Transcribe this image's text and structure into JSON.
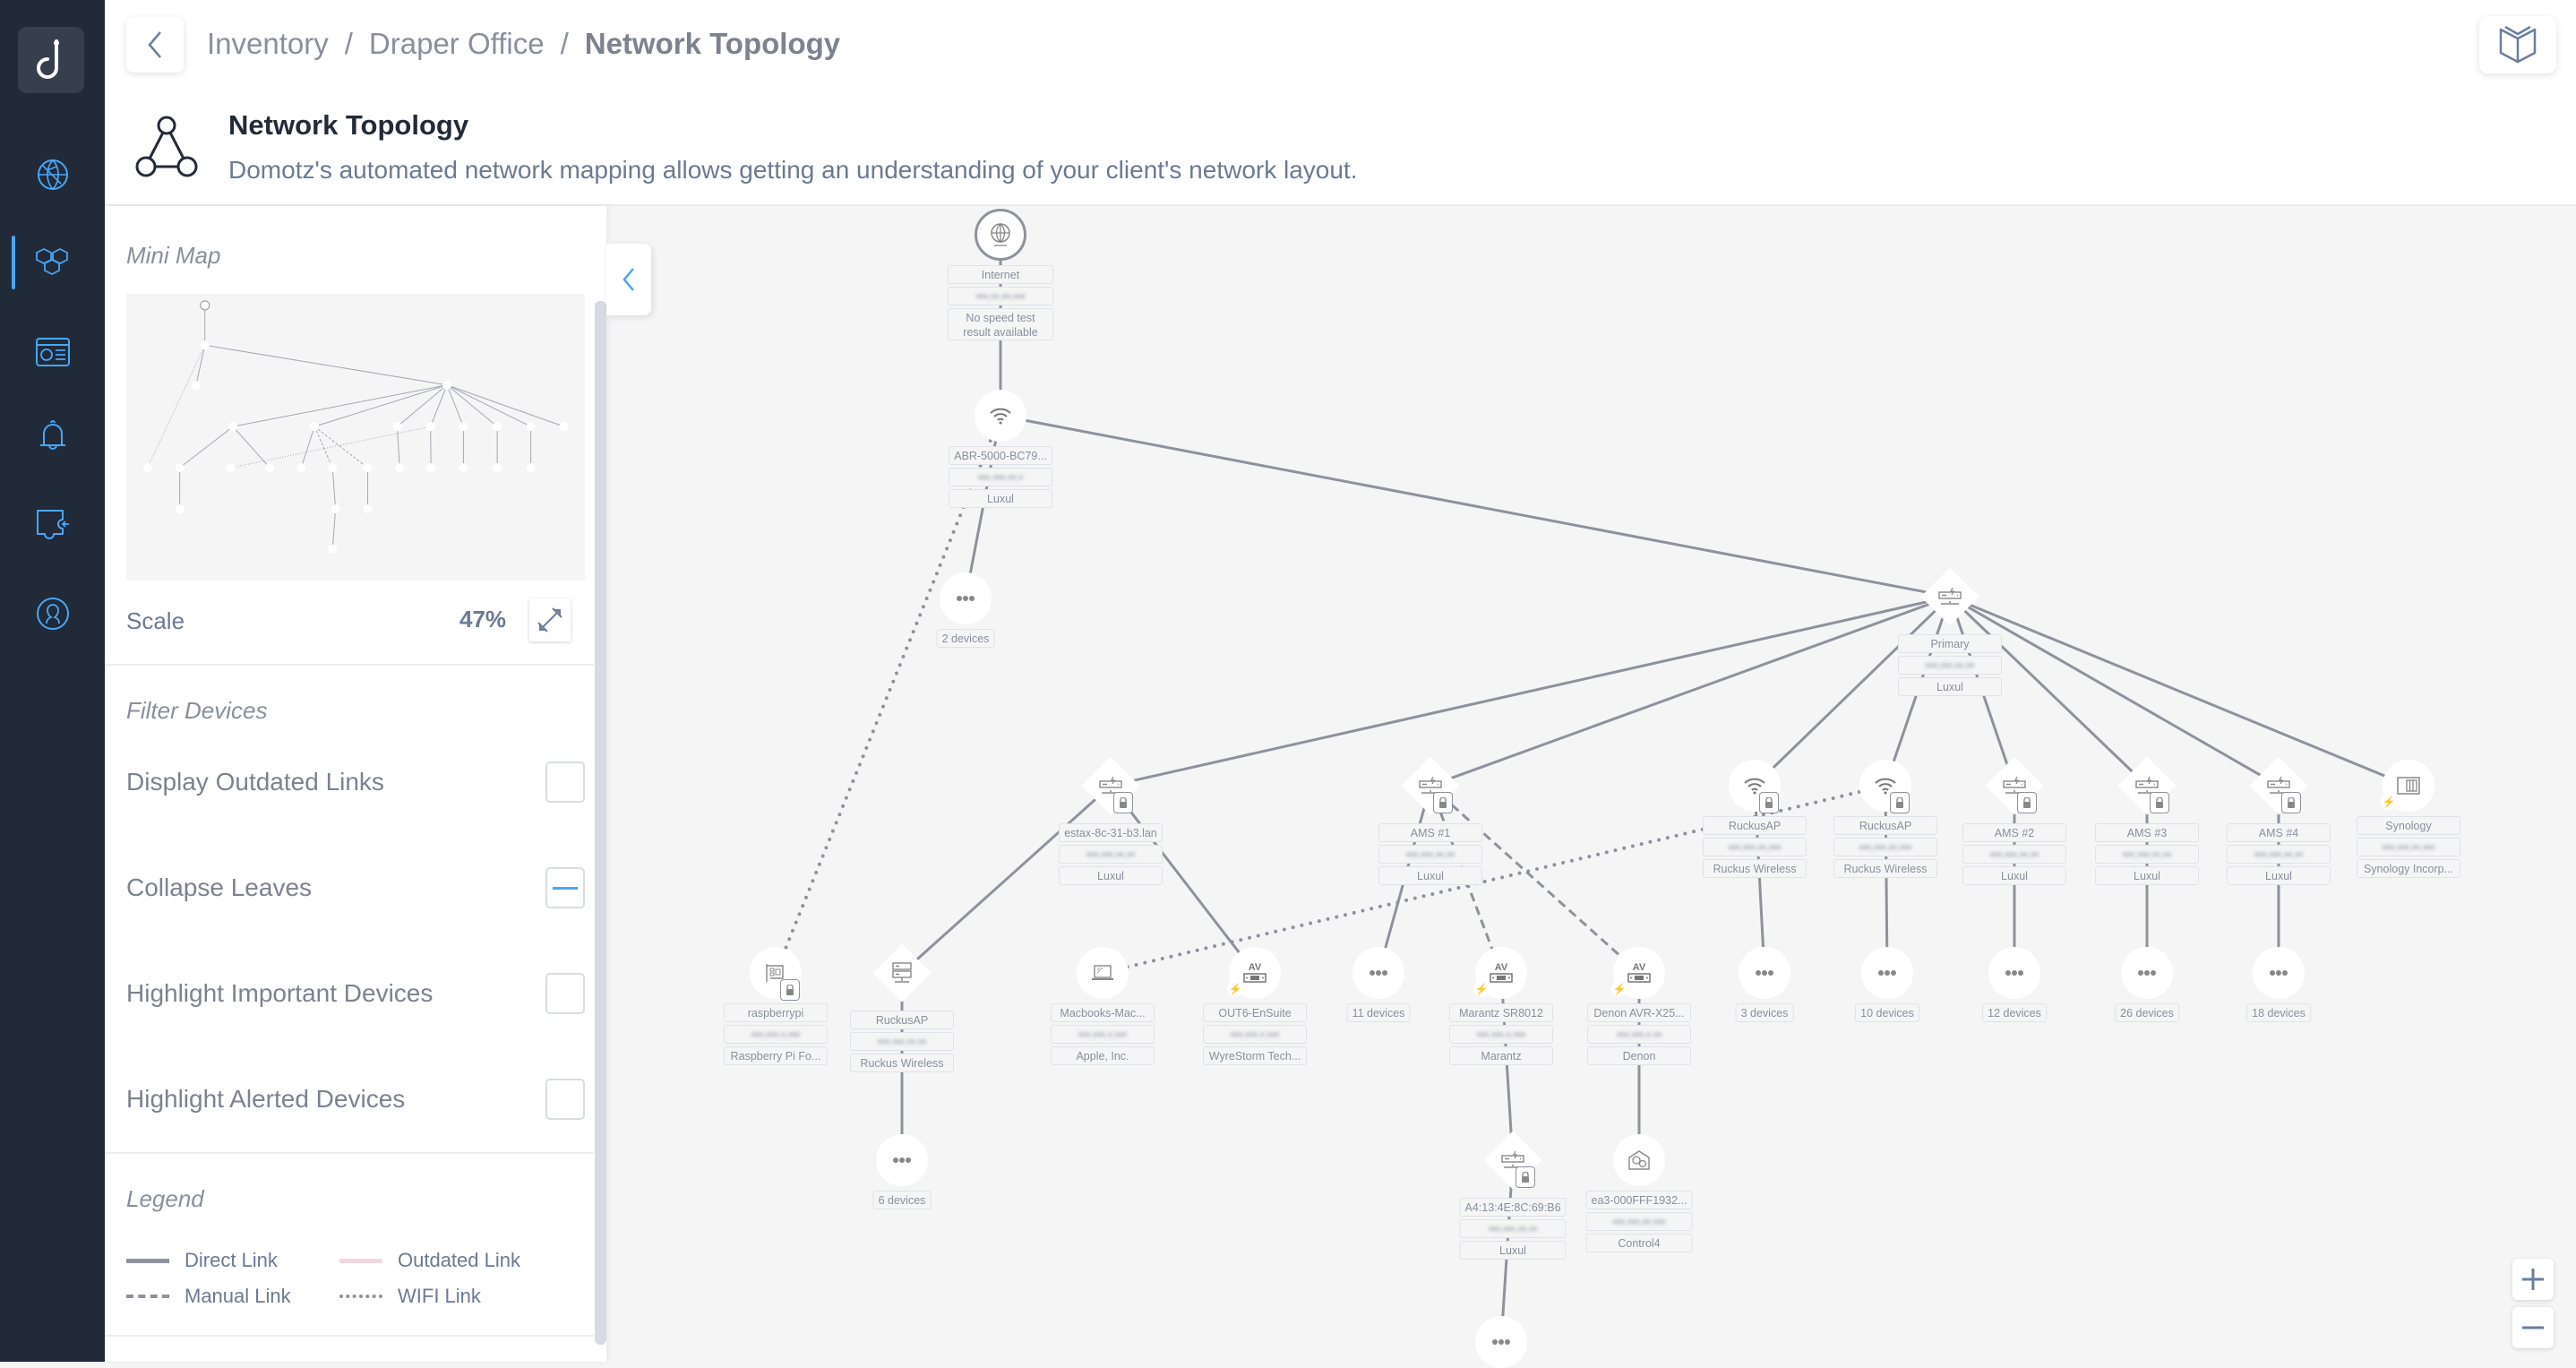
{
  "breadcrumb": {
    "items": [
      "Inventory",
      "Draper Office"
    ],
    "current": "Network Topology",
    "separator": "/"
  },
  "page": {
    "title": "Network Topology",
    "subtitle": "Domotz's automated network mapping allows getting an understanding of your client's network layout."
  },
  "sidebar": {
    "items": [
      {
        "icon": "globe-network-icon",
        "active": false
      },
      {
        "icon": "cubes-inventory-icon",
        "active": true
      },
      {
        "icon": "dashboard-window-icon",
        "active": false
      },
      {
        "icon": "bell-icon",
        "active": false
      },
      {
        "icon": "integration-puzzle-icon",
        "active": false
      },
      {
        "icon": "user-support-icon",
        "active": false
      }
    ]
  },
  "panel": {
    "minimap_title": "Mini Map",
    "scale_label": "Scale",
    "scale_value": "47%",
    "filter_title": "Filter Devices",
    "filters": [
      {
        "label": "Display Outdated Links",
        "state": "unchecked"
      },
      {
        "label": "Collapse Leaves",
        "state": "indeterminate"
      },
      {
        "label": "Highlight Important Devices",
        "state": "unchecked"
      },
      {
        "label": "Highlight Alerted Devices",
        "state": "unchecked"
      }
    ],
    "legend_title": "Legend",
    "legend": [
      {
        "label": "Direct Link",
        "style": "solid",
        "color": "#8f929c"
      },
      {
        "label": "Outdated Link",
        "style": "solid",
        "color": "#f4d6df"
      },
      {
        "label": "Manual Link",
        "style": "dashed",
        "color": "#8f929c"
      },
      {
        "label": "WIFI Link",
        "style": "dotted",
        "color": "#8f929c"
      }
    ]
  },
  "colors": {
    "accent": "#4aa6f5",
    "sidebar_bg": "#212a38",
    "link": "#8f929c",
    "text_muted": "#8a8f9c"
  },
  "topology": {
    "nodes": [
      {
        "id": "internet",
        "shape": "internet",
        "icon": "globe-icon",
        "labels": [
          "Internet",
          "•••.••.••.•••"
        ],
        "extra": "No speed test result available",
        "blur": [
          1
        ]
      },
      {
        "id": "abr",
        "shape": "circle",
        "icon": "wifi-icon",
        "labels": [
          "ABR-5000-BC79...",
          "•••.•••.••.•",
          "Luxul"
        ],
        "blur": [
          1
        ]
      },
      {
        "id": "g2",
        "shape": "circle",
        "icon": "more-dots-icon",
        "labels": [
          "2 devices"
        ]
      },
      {
        "id": "primary",
        "shape": "diamond",
        "icon": "switch-icon",
        "labels": [
          "Primary",
          "•••.•••.••.••",
          "Luxul"
        ],
        "blur": [
          1
        ]
      },
      {
        "id": "estax",
        "shape": "diamond",
        "icon": "switch-icon",
        "lock": true,
        "labels": [
          "estax-8c-31-b3.lan",
          "•••.•••.••.••",
          "Luxul"
        ],
        "blur": [
          1
        ]
      },
      {
        "id": "ams1",
        "shape": "diamond",
        "icon": "switch-icon",
        "lock": true,
        "labels": [
          "AMS #1",
          "•••.•••.••.••",
          "Luxul"
        ],
        "blur": [
          1
        ]
      },
      {
        "id": "ruckus1",
        "shape": "circle",
        "icon": "wifi-icon",
        "lock": true,
        "labels": [
          "RuckusAP",
          "•••.•••.••.•••",
          "Ruckus Wireless"
        ],
        "blur": [
          1
        ]
      },
      {
        "id": "ruckus2",
        "shape": "circle",
        "icon": "wifi-icon",
        "lock": true,
        "labels": [
          "RuckusAP",
          "•••.•••.••.•••",
          "Ruckus Wireless"
        ],
        "blur": [
          1
        ]
      },
      {
        "id": "ams2",
        "shape": "diamond",
        "icon": "switch-icon",
        "lock": true,
        "labels": [
          "AMS #2",
          "•••.•••.••.••",
          "Luxul"
        ],
        "blur": [
          1
        ]
      },
      {
        "id": "ams3",
        "shape": "diamond",
        "icon": "switch-icon",
        "lock": true,
        "labels": [
          "AMS #3",
          "•••.•••.••.••",
          "Luxul"
        ],
        "blur": [
          1
        ]
      },
      {
        "id": "ams4",
        "shape": "diamond",
        "icon": "switch-icon",
        "lock": true,
        "labels": [
          "AMS #4",
          "•••.•••.••.••",
          "Luxul"
        ],
        "blur": [
          1
        ]
      },
      {
        "id": "synology",
        "shape": "circle",
        "icon": "nas-icon",
        "bolt": true,
        "labels": [
          "Synology",
          "•••.•••.••.•••",
          "Synology Incorp..."
        ],
        "blur": [
          1
        ]
      },
      {
        "id": "rpi",
        "shape": "circle",
        "icon": "circuit-board-icon",
        "lock": true,
        "labels": [
          "raspberrypi",
          "•••.•••.•.•••",
          "Raspberry Pi Fo..."
        ],
        "blur": [
          1
        ]
      },
      {
        "id": "ruckus3",
        "shape": "diamond",
        "icon": "server-icon",
        "labels": [
          "RuckusAP",
          "•••.•••.••.••",
          "Ruckus Wireless"
        ],
        "blur": [
          1
        ]
      },
      {
        "id": "mac",
        "shape": "circle",
        "icon": "laptop-icon",
        "labels": [
          "Macbooks-Mac...",
          "•••.•••.•.•••",
          "Apple, Inc."
        ],
        "blur": [
          1
        ]
      },
      {
        "id": "out6",
        "shape": "circle",
        "icon": "av-receiver-icon",
        "bolt": true,
        "labels": [
          "OUT6-EnSuite",
          "•••.•••.•.•••",
          "WyreStorm Tech..."
        ],
        "blur": [
          1
        ]
      },
      {
        "id": "g11",
        "shape": "circle",
        "icon": "more-dots-icon",
        "labels": [
          "11 devices"
        ]
      },
      {
        "id": "marantz",
        "shape": "circle",
        "icon": "av-receiver-icon",
        "bolt": true,
        "labels": [
          "Marantz SR8012",
          "•••.•••.•.•••",
          "Marantz"
        ],
        "blur": [
          1
        ]
      },
      {
        "id": "denon",
        "shape": "circle",
        "icon": "av-receiver-icon",
        "bolt": true,
        "labels": [
          "Denon AVR-X25...",
          "•••.•••.•.••",
          "Denon"
        ],
        "blur": [
          1
        ]
      },
      {
        "id": "g3",
        "shape": "circle",
        "icon": "more-dots-icon",
        "labels": [
          "3 devices"
        ]
      },
      {
        "id": "g10",
        "shape": "circle",
        "icon": "more-dots-icon",
        "labels": [
          "10 devices"
        ]
      },
      {
        "id": "g12",
        "shape": "circle",
        "icon": "more-dots-icon",
        "labels": [
          "12 devices"
        ]
      },
      {
        "id": "g26",
        "shape": "circle",
        "icon": "more-dots-icon",
        "labels": [
          "26 devices"
        ]
      },
      {
        "id": "g18",
        "shape": "circle",
        "icon": "more-dots-icon",
        "labels": [
          "18 devices"
        ]
      },
      {
        "id": "g6",
        "shape": "circle",
        "icon": "more-dots-icon",
        "labels": [
          "6 devices"
        ]
      },
      {
        "id": "a4",
        "shape": "diamond",
        "icon": "switch-icon",
        "lock": true,
        "labels": [
          "A4:13:4E:8C:69:B6",
          "•••.•••.••.••",
          "Luxul"
        ],
        "blur": [
          1
        ]
      },
      {
        "id": "ea3",
        "shape": "circle",
        "icon": "home-automation-icon",
        "labels": [
          "ea3-000FFF1932...",
          "•••.•••.••.•••",
          "Control4"
        ],
        "blur": [
          1
        ]
      },
      {
        "id": "gbottom",
        "shape": "circle",
        "icon": "more-dots-icon",
        "labels": []
      }
    ],
    "links": [
      {
        "from": "internet",
        "to": "abr",
        "type": "direct"
      },
      {
        "from": "abr",
        "to": "g2",
        "type": "direct"
      },
      {
        "from": "abr",
        "to": "primary",
        "type": "direct"
      },
      {
        "from": "abr",
        "to": "rpi",
        "type": "wifi"
      },
      {
        "from": "primary",
        "to": "estax",
        "type": "direct"
      },
      {
        "from": "primary",
        "to": "ams1",
        "type": "direct"
      },
      {
        "from": "primary",
        "to": "ruckus1",
        "type": "direct"
      },
      {
        "from": "primary",
        "to": "ruckus2",
        "type": "direct"
      },
      {
        "from": "primary",
        "to": "ams2",
        "type": "direct"
      },
      {
        "from": "primary",
        "to": "ams3",
        "type": "direct"
      },
      {
        "from": "primary",
        "to": "ams4",
        "type": "direct"
      },
      {
        "from": "primary",
        "to": "synology",
        "type": "direct"
      },
      {
        "from": "estax",
        "to": "ruckus3",
        "type": "direct"
      },
      {
        "from": "estax",
        "to": "out6",
        "type": "direct"
      },
      {
        "from": "ruckus2",
        "to": "mac",
        "type": "wifi"
      },
      {
        "from": "ams1",
        "to": "g11",
        "type": "direct"
      },
      {
        "from": "ams1",
        "to": "marantz",
        "type": "manual"
      },
      {
        "from": "ams1",
        "to": "denon",
        "type": "manual"
      },
      {
        "from": "ruckus1",
        "to": "g3",
        "type": "direct"
      },
      {
        "from": "ruckus2",
        "to": "g10",
        "type": "direct"
      },
      {
        "from": "ams2",
        "to": "g12",
        "type": "direct"
      },
      {
        "from": "ams3",
        "to": "g26",
        "type": "direct"
      },
      {
        "from": "ams4",
        "to": "g18",
        "type": "direct"
      },
      {
        "from": "ruckus3",
        "to": "g6",
        "type": "direct"
      },
      {
        "from": "marantz",
        "to": "a4",
        "type": "direct"
      },
      {
        "from": "denon",
        "to": "ea3",
        "type": "direct"
      },
      {
        "from": "a4",
        "to": "gbottom",
        "type": "direct"
      }
    ]
  },
  "zoom_controls": {
    "zoom_in": "+",
    "zoom_out": "−"
  }
}
